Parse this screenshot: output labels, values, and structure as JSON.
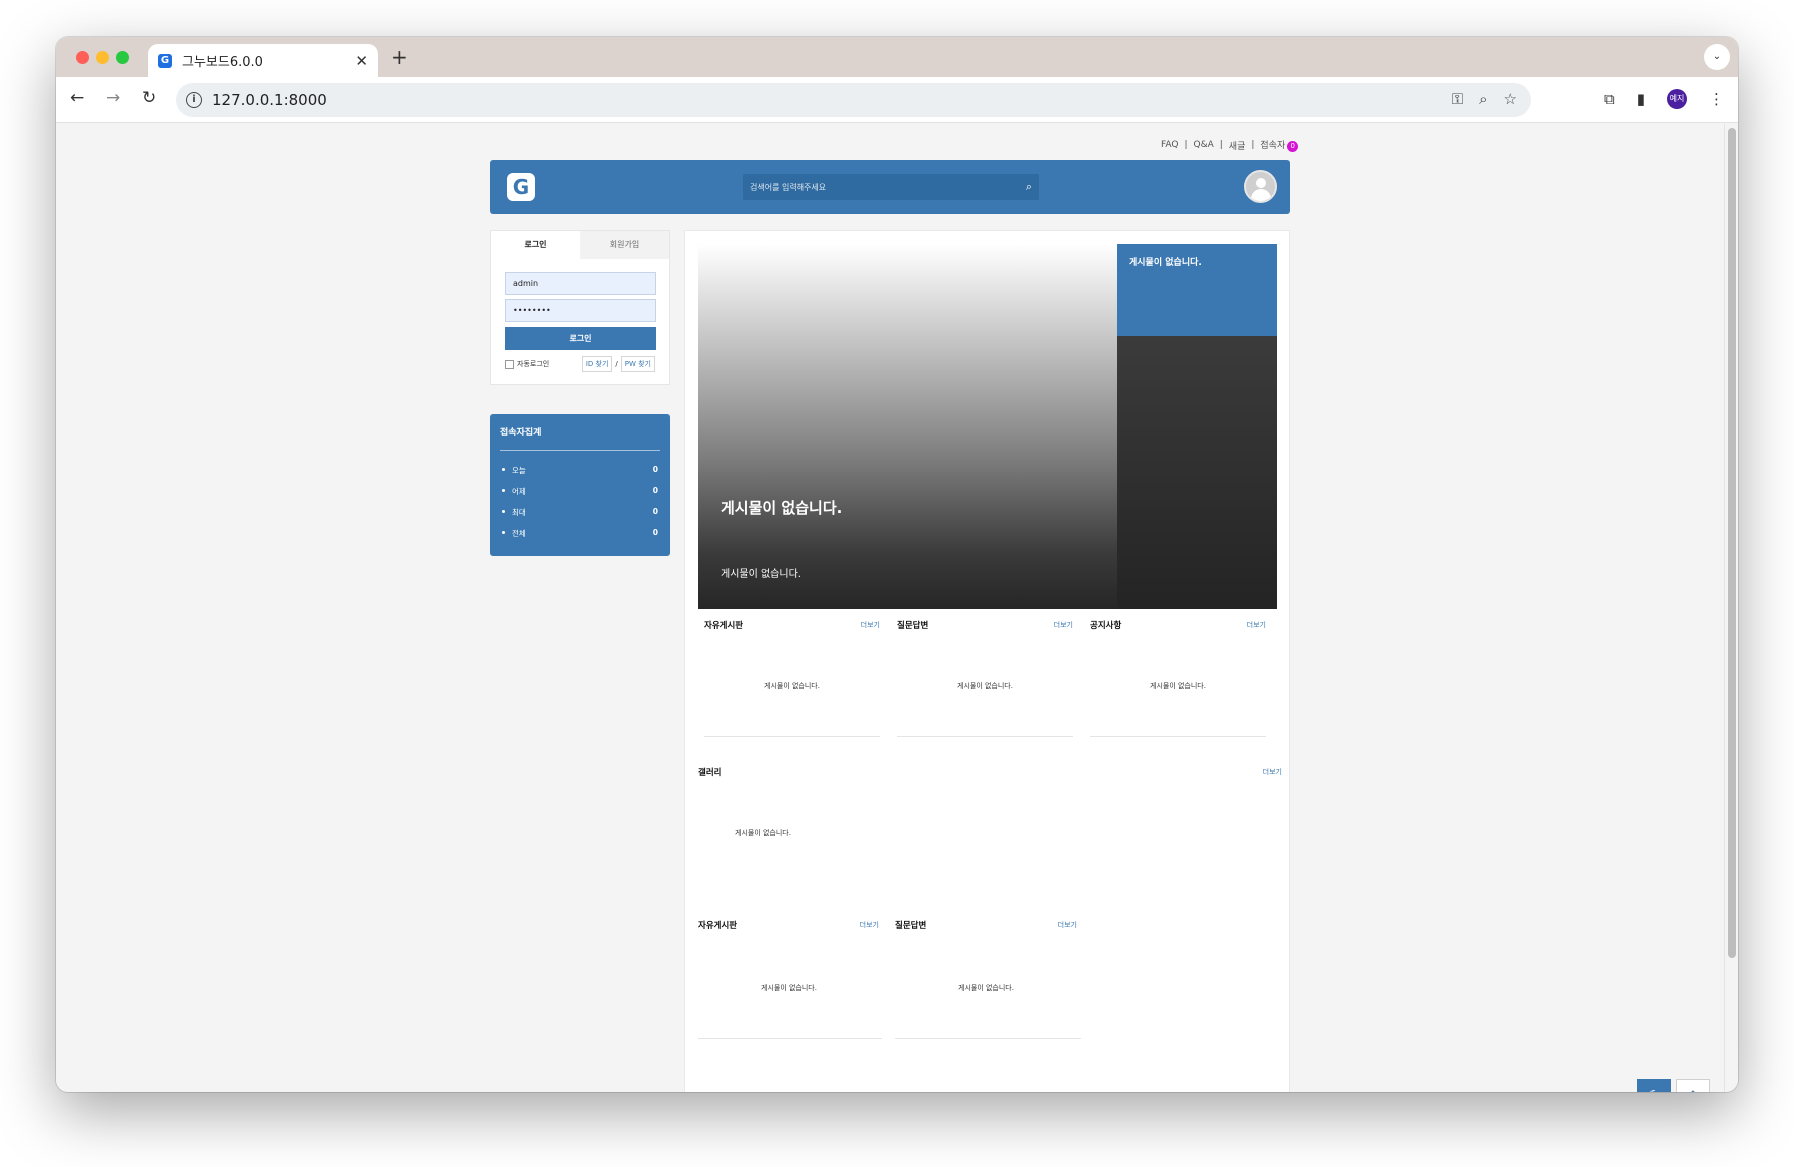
{
  "browser": {
    "tab_title": "그누보드6.0.0",
    "tab_favicon": "G",
    "url": "127.0.0.1:8000",
    "profile_label": "예지"
  },
  "site": {
    "top_menu": [
      "FAQ",
      "Q&A",
      "새글",
      "접속자"
    ],
    "visitor_badge": "0",
    "search_placeholder": "검색어를 입력해주세요",
    "login": {
      "tab_login": "로그인",
      "tab_join": "회원가입",
      "id_value": "admin",
      "pw_value": "••••••••",
      "button": "로그인",
      "auto_login": "자동로그인",
      "find_id": "ID 찾기",
      "find_sep": "/",
      "find_pw": "PW 찾기"
    },
    "visit": {
      "title": "접속자집계",
      "rows": [
        {
          "label": "오늘",
          "value": "0"
        },
        {
          "label": "어제",
          "value": "0"
        },
        {
          "label": "최대",
          "value": "0"
        },
        {
          "label": "전체",
          "value": "0"
        }
      ]
    },
    "hero": {
      "title": "게시물이 없습니다.",
      "subtitle": "게시물이 없습니다.",
      "side_title": "게시물이 없습니다."
    },
    "more_label": "더보기",
    "empty_text": "게시물이 없습니다.",
    "boards_row1": [
      "자유게시판",
      "질문답변",
      "공지사항"
    ],
    "gallery_title": "갤러리",
    "boards_row3": [
      "자유게시판",
      "질문답변"
    ]
  },
  "colors": {
    "brand": "#3b78b2",
    "badge": "#d414d4"
  }
}
